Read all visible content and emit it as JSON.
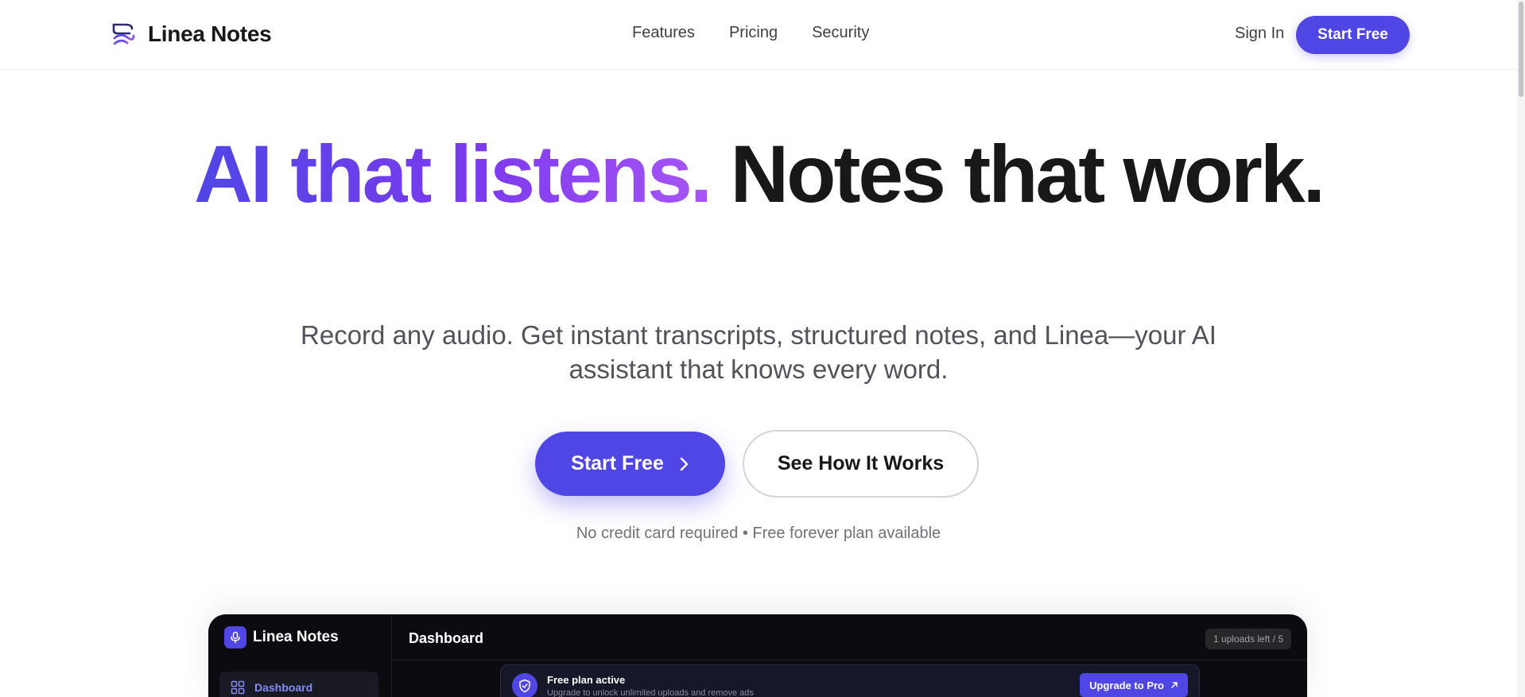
{
  "nav": {
    "brand": "Linea Notes",
    "links": [
      "Features",
      "Pricing",
      "Security"
    ],
    "sign_in": "Sign In",
    "cta": "Start Free"
  },
  "hero": {
    "title_gradient": "AI that listens.",
    "title_rest": "Notes that work.",
    "subtitle": "Record any audio. Get instant transcripts, structured notes, and Linea—your AI assistant that knows every word.",
    "primary_cta": "Start Free",
    "secondary_cta": "See How It Works",
    "note": "No credit card required • Free forever plan available"
  },
  "preview": {
    "brand": "Linea Notes",
    "header_title": "Dashboard",
    "uploads_badge": "1 uploads left / 5",
    "sidebar_items": [
      "Dashboard"
    ],
    "banner": {
      "title": "Free plan active",
      "subtitle": "Upgrade to unlock unlimited uploads and remove ads",
      "button": "Upgrade to Pro"
    }
  },
  "colors": {
    "primary": "#4f46e5",
    "gradient_start": "#4f46e5",
    "gradient_end": "#a855f7",
    "preview_bg": "#0c0c10"
  },
  "icons": {
    "brand": "wave-stack-logo-icon",
    "cta_arrow": "chevron-right-icon",
    "preview_logo": "microphone-icon",
    "dashboard": "grid-icon",
    "banner": "shield-check-icon",
    "upgrade": "arrow-up-right-icon"
  }
}
